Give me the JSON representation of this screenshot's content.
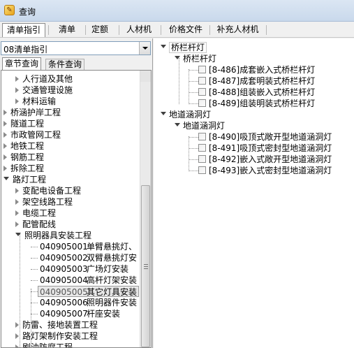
{
  "window": {
    "title": "查询",
    "app_icon": "app-logo-icon"
  },
  "tabs": [
    {
      "label": "清单指引",
      "active": true
    },
    {
      "label": "清单"
    },
    {
      "label": "定额"
    },
    {
      "label": "人材机"
    },
    {
      "label": "价格文件"
    },
    {
      "label": "补充人材机"
    }
  ],
  "left": {
    "combo_value": "08清单指引",
    "subtabs": [
      {
        "label": "章节查询",
        "active": true
      },
      {
        "label": "条件查询"
      }
    ],
    "tree": [
      {
        "label": "人行道及其他"
      },
      {
        "label": "交通管理设施"
      },
      {
        "label": "材料运输"
      },
      {
        "label": "桥涵护岸工程"
      },
      {
        "label": "隧道工程"
      },
      {
        "label": "市政管网工程"
      },
      {
        "label": "地铁工程"
      },
      {
        "label": "钢筋工程"
      },
      {
        "label": "拆除工程"
      },
      {
        "label": "路灯工程"
      },
      {
        "label": "变配电设备工程"
      },
      {
        "label": "架空线路工程"
      },
      {
        "label": "电缆工程"
      },
      {
        "label": "配管配线"
      },
      {
        "label": "照明器具安装工程"
      },
      {
        "code": "040905001",
        "label": "单臂悬挑灯、"
      },
      {
        "code": "040905002",
        "label": "双臂悬挑灯安"
      },
      {
        "code": "040905003",
        "label": "广场灯安装"
      },
      {
        "code": "040905004",
        "label": "高杆灯架安装"
      },
      {
        "code": "040905005",
        "label": "其它灯具安装"
      },
      {
        "code": "040905006",
        "label": "照明器件安装"
      },
      {
        "code": "040905007",
        "label": "杆座安装"
      },
      {
        "label": "防雷、接地装置工程"
      },
      {
        "label": "路灯架制作安装工程"
      },
      {
        "label": "刷油防腐工程"
      }
    ]
  },
  "right": {
    "groups": [
      {
        "label": "桥栏杆灯",
        "sub": "桥栏杆灯",
        "items": [
          "[8-486]成套嵌入式桥栏杆灯",
          "[8-487]成套明装式桥栏杆灯",
          "[8-488]组装嵌入式桥栏杆灯",
          "[8-489]组装明装式桥栏杆灯"
        ]
      },
      {
        "label": "地道涵洞灯",
        "sub": "地道涵洞灯",
        "items": [
          "[8-490]吸顶式敞开型地道涵洞灯",
          "[8-491]吸顶式密封型地道涵洞灯",
          "[8-492]嵌入式敞开型地道涵洞灯",
          "[8-493]嵌入式密封型地道涵洞灯"
        ]
      }
    ]
  }
}
